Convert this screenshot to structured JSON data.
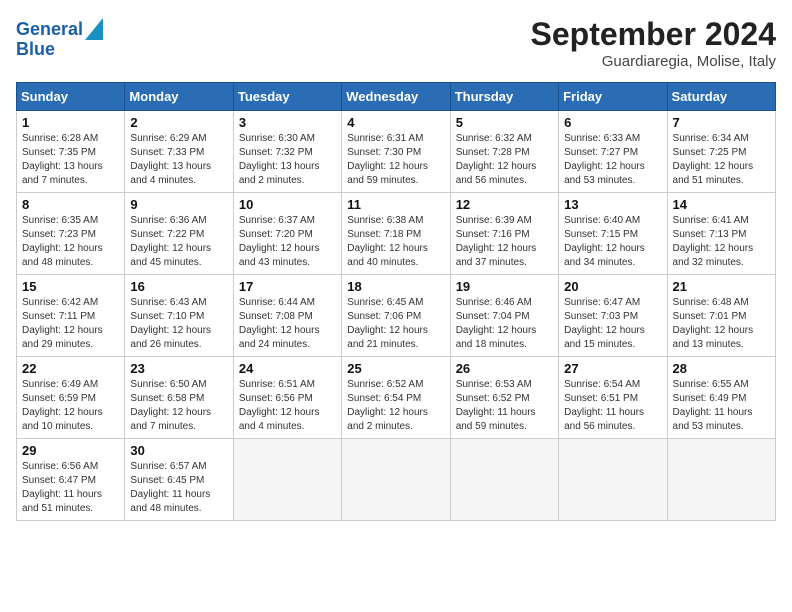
{
  "logo": {
    "line1": "General",
    "line2": "Blue"
  },
  "title": "September 2024",
  "location": "Guardiaregia, Molise, Italy",
  "weekdays": [
    "Sunday",
    "Monday",
    "Tuesday",
    "Wednesday",
    "Thursday",
    "Friday",
    "Saturday"
  ],
  "weeks": [
    [
      {
        "day": "1",
        "sunrise": "6:28 AM",
        "sunset": "7:35 PM",
        "daylight": "13 hours and 7 minutes."
      },
      {
        "day": "2",
        "sunrise": "6:29 AM",
        "sunset": "7:33 PM",
        "daylight": "13 hours and 4 minutes."
      },
      {
        "day": "3",
        "sunrise": "6:30 AM",
        "sunset": "7:32 PM",
        "daylight": "13 hours and 2 minutes."
      },
      {
        "day": "4",
        "sunrise": "6:31 AM",
        "sunset": "7:30 PM",
        "daylight": "12 hours and 59 minutes."
      },
      {
        "day": "5",
        "sunrise": "6:32 AM",
        "sunset": "7:28 PM",
        "daylight": "12 hours and 56 minutes."
      },
      {
        "day": "6",
        "sunrise": "6:33 AM",
        "sunset": "7:27 PM",
        "daylight": "12 hours and 53 minutes."
      },
      {
        "day": "7",
        "sunrise": "6:34 AM",
        "sunset": "7:25 PM",
        "daylight": "12 hours and 51 minutes."
      }
    ],
    [
      {
        "day": "8",
        "sunrise": "6:35 AM",
        "sunset": "7:23 PM",
        "daylight": "12 hours and 48 minutes."
      },
      {
        "day": "9",
        "sunrise": "6:36 AM",
        "sunset": "7:22 PM",
        "daylight": "12 hours and 45 minutes."
      },
      {
        "day": "10",
        "sunrise": "6:37 AM",
        "sunset": "7:20 PM",
        "daylight": "12 hours and 43 minutes."
      },
      {
        "day": "11",
        "sunrise": "6:38 AM",
        "sunset": "7:18 PM",
        "daylight": "12 hours and 40 minutes."
      },
      {
        "day": "12",
        "sunrise": "6:39 AM",
        "sunset": "7:16 PM",
        "daylight": "12 hours and 37 minutes."
      },
      {
        "day": "13",
        "sunrise": "6:40 AM",
        "sunset": "7:15 PM",
        "daylight": "12 hours and 34 minutes."
      },
      {
        "day": "14",
        "sunrise": "6:41 AM",
        "sunset": "7:13 PM",
        "daylight": "12 hours and 32 minutes."
      }
    ],
    [
      {
        "day": "15",
        "sunrise": "6:42 AM",
        "sunset": "7:11 PM",
        "daylight": "12 hours and 29 minutes."
      },
      {
        "day": "16",
        "sunrise": "6:43 AM",
        "sunset": "7:10 PM",
        "daylight": "12 hours and 26 minutes."
      },
      {
        "day": "17",
        "sunrise": "6:44 AM",
        "sunset": "7:08 PM",
        "daylight": "12 hours and 24 minutes."
      },
      {
        "day": "18",
        "sunrise": "6:45 AM",
        "sunset": "7:06 PM",
        "daylight": "12 hours and 21 minutes."
      },
      {
        "day": "19",
        "sunrise": "6:46 AM",
        "sunset": "7:04 PM",
        "daylight": "12 hours and 18 minutes."
      },
      {
        "day": "20",
        "sunrise": "6:47 AM",
        "sunset": "7:03 PM",
        "daylight": "12 hours and 15 minutes."
      },
      {
        "day": "21",
        "sunrise": "6:48 AM",
        "sunset": "7:01 PM",
        "daylight": "12 hours and 13 minutes."
      }
    ],
    [
      {
        "day": "22",
        "sunrise": "6:49 AM",
        "sunset": "6:59 PM",
        "daylight": "12 hours and 10 minutes."
      },
      {
        "day": "23",
        "sunrise": "6:50 AM",
        "sunset": "6:58 PM",
        "daylight": "12 hours and 7 minutes."
      },
      {
        "day": "24",
        "sunrise": "6:51 AM",
        "sunset": "6:56 PM",
        "daylight": "12 hours and 4 minutes."
      },
      {
        "day": "25",
        "sunrise": "6:52 AM",
        "sunset": "6:54 PM",
        "daylight": "12 hours and 2 minutes."
      },
      {
        "day": "26",
        "sunrise": "6:53 AM",
        "sunset": "6:52 PM",
        "daylight": "11 hours and 59 minutes."
      },
      {
        "day": "27",
        "sunrise": "6:54 AM",
        "sunset": "6:51 PM",
        "daylight": "11 hours and 56 minutes."
      },
      {
        "day": "28",
        "sunrise": "6:55 AM",
        "sunset": "6:49 PM",
        "daylight": "11 hours and 53 minutes."
      }
    ],
    [
      {
        "day": "29",
        "sunrise": "6:56 AM",
        "sunset": "6:47 PM",
        "daylight": "11 hours and 51 minutes."
      },
      {
        "day": "30",
        "sunrise": "6:57 AM",
        "sunset": "6:45 PM",
        "daylight": "11 hours and 48 minutes."
      },
      null,
      null,
      null,
      null,
      null
    ]
  ],
  "labels": {
    "sunrise": "Sunrise:",
    "sunset": "Sunset:",
    "daylight": "Daylight:"
  }
}
